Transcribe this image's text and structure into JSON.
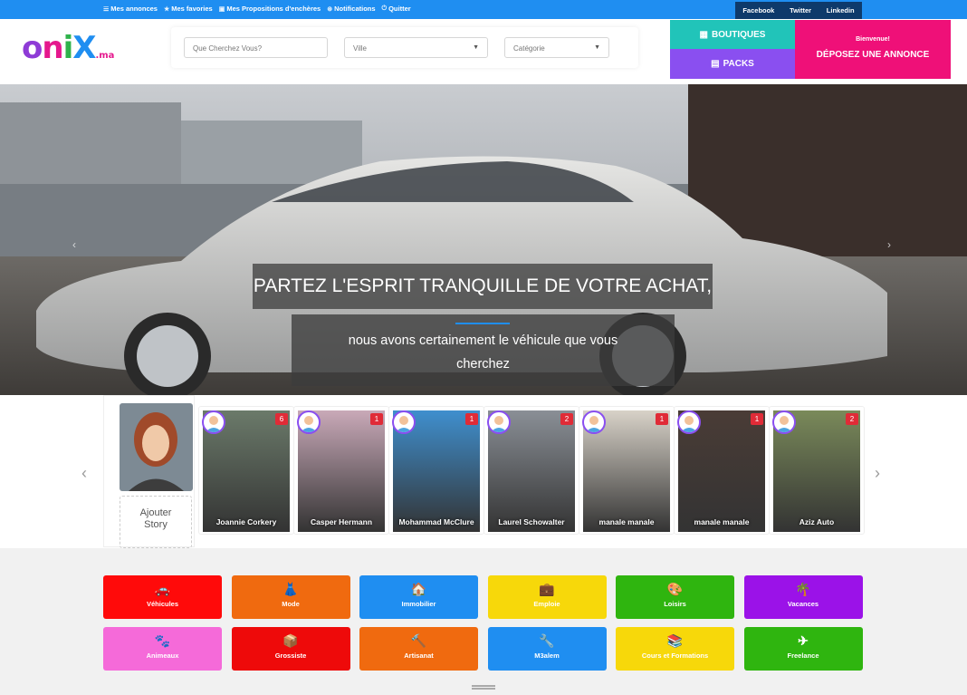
{
  "topbar": {
    "links": [
      {
        "icon": "list-icon",
        "label": "Mes annonces"
      },
      {
        "icon": "star-icon",
        "label": "Mes favories"
      },
      {
        "icon": "image-icon",
        "label": "Mes Propositions d'enchères"
      },
      {
        "icon": "bell-icon",
        "label": "Notifications"
      },
      {
        "icon": "power-icon",
        "label": "Quitter"
      }
    ],
    "social": [
      "Facebook",
      "Twitter",
      "Linkedin"
    ]
  },
  "logo": {
    "main": "oniX",
    "suffix": ".ma"
  },
  "search": {
    "query_placeholder": "Que Cherchez Vous?",
    "city_placeholder": "Ville",
    "category_placeholder": "Catégorie"
  },
  "buttons": {
    "boutiques": "BOUTIQUES",
    "packs": "PACKS",
    "welcome": "Bienvenue!",
    "post_ad": "DÉPOSEZ UNE ANNONCE"
  },
  "hero": {
    "title": "PARTEZ L'ESPRIT TRANQUILLE DE VOTRE ACHAT,",
    "subtitle_line1": "nous avons certainement le véhicule que vous",
    "subtitle_line2": "cherchez"
  },
  "stories": {
    "add_label_line1": "Ajouter",
    "add_label_line2": "Story",
    "items": [
      {
        "name": "Joannie Corkery",
        "count": "6",
        "scene": "waterfall",
        "color": "#6b7a6a"
      },
      {
        "name": "Casper Hermann",
        "count": "1",
        "scene": "stone",
        "color": "#c9a9b8"
      },
      {
        "name": "Mohammad McClure",
        "count": "1",
        "scene": "milk",
        "color": "#3f8fce"
      },
      {
        "name": "Laurel Schowalter",
        "count": "2",
        "scene": "car",
        "color": "#8a8f96"
      },
      {
        "name": "manale manale",
        "count": "1",
        "scene": "eggs",
        "color": "#d8d2c8"
      },
      {
        "name": "manale manale",
        "count": "1",
        "scene": "redcar",
        "color": "#4a3c36"
      },
      {
        "name": "Aziz Auto",
        "count": "2",
        "scene": "falls",
        "color": "#7a8a5a"
      }
    ]
  },
  "categories": [
    {
      "label": "Véhicules",
      "icon": "car-icon",
      "glyph": "🚗",
      "color": "#ff0a0a"
    },
    {
      "label": "Mode",
      "icon": "fashion-icon",
      "glyph": "👗",
      "color": "#f06a0f"
    },
    {
      "label": "Immobilier",
      "icon": "house-icon",
      "glyph": "🏠",
      "color": "#1f8ef1"
    },
    {
      "label": "Emploie",
      "icon": "briefcase-icon",
      "glyph": "💼",
      "color": "#f7d80a"
    },
    {
      "label": "Loisirs",
      "icon": "leisure-icon",
      "glyph": "🎨",
      "color": "#2fb50f"
    },
    {
      "label": "Vacances",
      "icon": "vacation-icon",
      "glyph": "🌴",
      "color": "#9b12e8"
    },
    {
      "label": "Animeaux",
      "icon": "animal-icon",
      "glyph": "🐾",
      "color": "#f56ad9"
    },
    {
      "label": "Grossiste",
      "icon": "wholesale-icon",
      "glyph": "📦",
      "color": "#ee0a0a"
    },
    {
      "label": "Artisanat",
      "icon": "craft-icon",
      "glyph": "🔨",
      "color": "#f06a0f"
    },
    {
      "label": "M3alem",
      "icon": "worker-icon",
      "glyph": "🔧",
      "color": "#1f8ef1"
    },
    {
      "label": "Cours et Formations",
      "icon": "course-icon",
      "glyph": "📚",
      "color": "#f7d80a"
    },
    {
      "label": "Freelance",
      "icon": "send-icon",
      "glyph": "✈",
      "color": "#2fb50f"
    }
  ]
}
